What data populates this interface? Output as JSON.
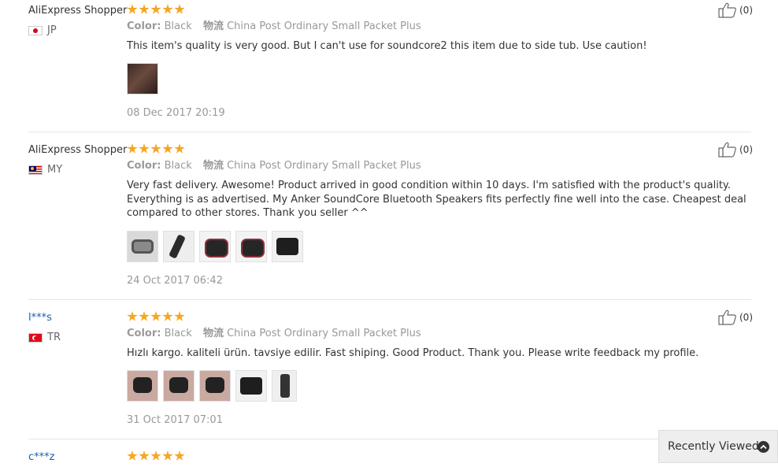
{
  "reviews": [
    {
      "name": "AliExpress Shopper",
      "country": "JP",
      "color_label": "Color:",
      "color_value": "Black",
      "shipping_label": "物流",
      "shipping_value": "China Post Ordinary Small Packet Plus",
      "text": "This item's quality is very good. But I can't use for soundcore2 this item due to side tub. Use caution!",
      "date": "08 Dec 2017 20:19",
      "likes": "(0)"
    },
    {
      "name": "AliExpress Shopper",
      "country": "MY",
      "color_label": "Color:",
      "color_value": "Black",
      "shipping_label": "物流",
      "shipping_value": "China Post Ordinary Small Packet Plus",
      "text": "Very fast delivery. Awesome! Product arrived in good condition within 10 days. I'm satisfied with the product's quality. Everything is as advertised. My Anker SoundCore Bluetooth Speakers fits perfectly fine well into the case. Cheapest deal compared to other stores. Thank you seller ^^",
      "date": "24 Oct 2017 06:42",
      "likes": "(0)"
    },
    {
      "name": "l***s",
      "country": "TR",
      "color_label": "Color:",
      "color_value": "Black",
      "shipping_label": "物流",
      "shipping_value": "China Post Ordinary Small Packet Plus",
      "text": "Hızlı kargo. kaliteli ürün. tavsiye edilir. Fast shiping. Good Product. Thank you. Please write feedback my profile.",
      "date": "31 Oct 2017 07:01",
      "likes": "(0)"
    },
    {
      "name": "c***z"
    }
  ],
  "recently_viewed": {
    "label": "Recently Viewed",
    "icon": "chevron-up-icon"
  },
  "colors": {
    "star": "#f5a623",
    "link_name": "#1a5fa8"
  }
}
